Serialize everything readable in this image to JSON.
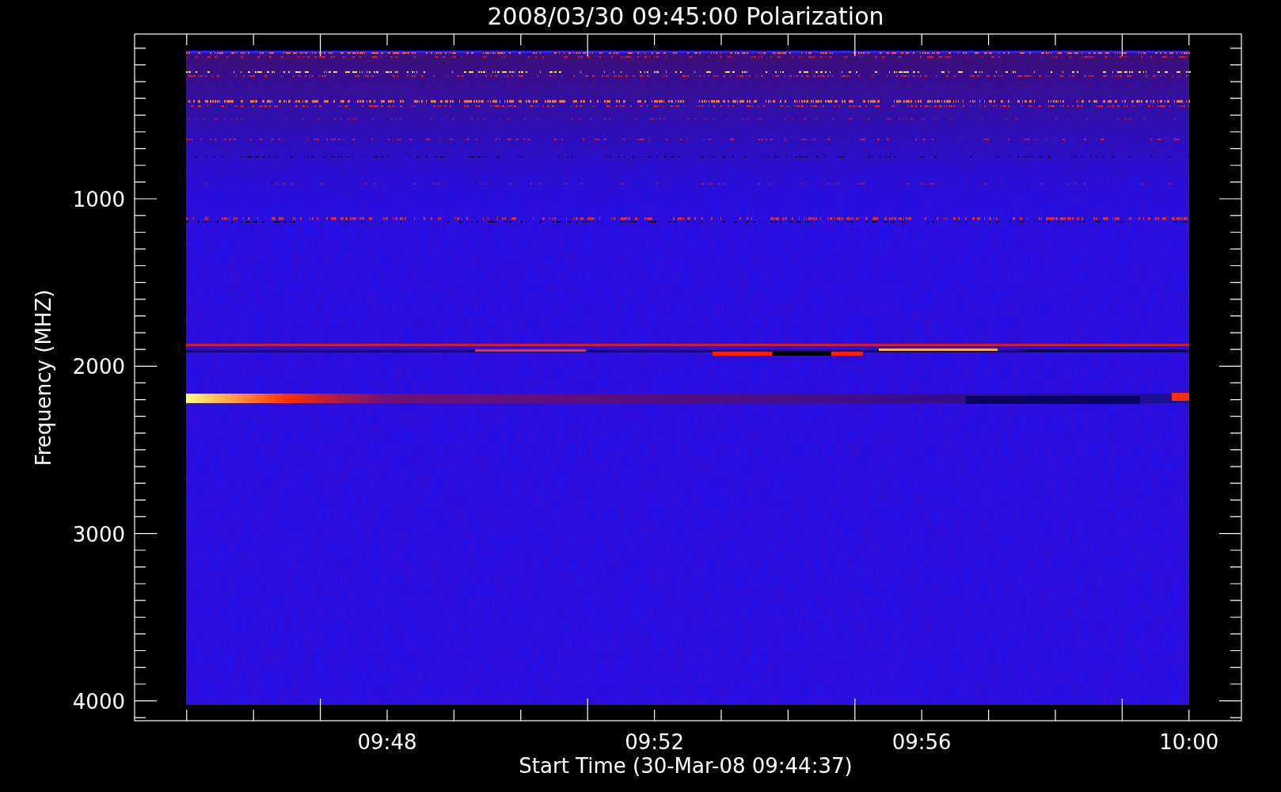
{
  "title": "2008/03/30 09:45:00 Polarization",
  "xlabel": "Start Time (30-Mar-08 09:44:37)",
  "ylabel": "Frequency (MHZ)",
  "x_tick_labels": [
    "09:48",
    "09:52",
    "09:56",
    "10:00"
  ],
  "y_tick_labels": [
    "1000",
    "2000",
    "3000",
    "4000"
  ]
}
